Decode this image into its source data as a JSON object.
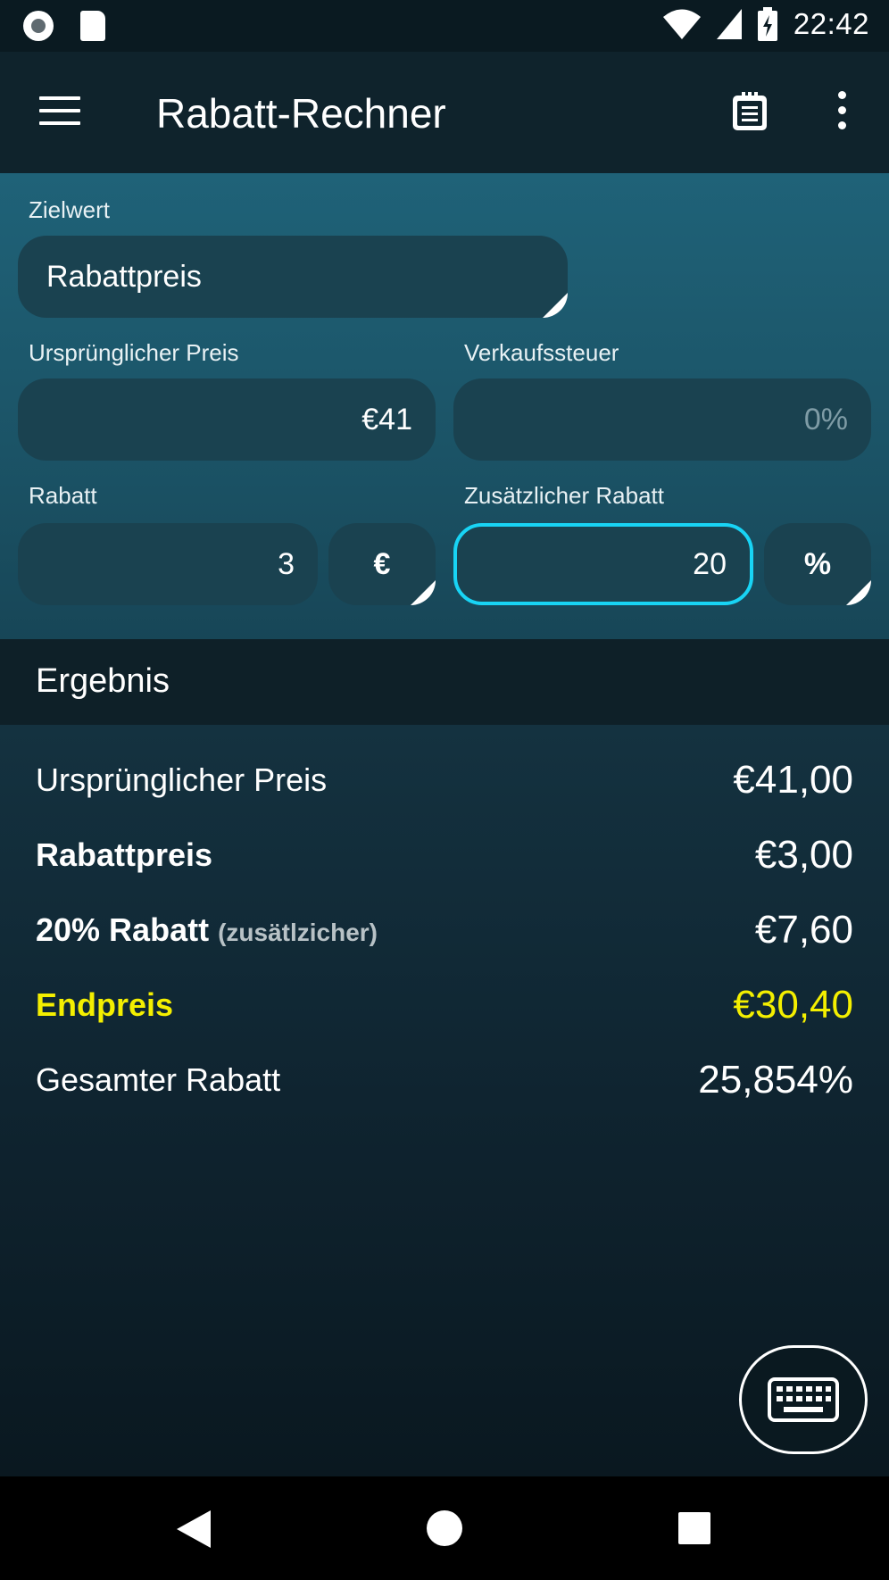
{
  "status_bar": {
    "time": "22:42",
    "icons": [
      "record-icon",
      "sd-card-icon",
      "wifi-icon",
      "signal-icon",
      "battery-charging-icon"
    ]
  },
  "app_bar": {
    "title": "Rabatt-Rechner",
    "icons": [
      "menu-icon",
      "clipboard-icon",
      "more-vert-icon"
    ]
  },
  "form": {
    "target_label": "Zielwert",
    "target_value": "Rabattpreis",
    "original_price_label": "Ursprünglicher Preis",
    "original_price_value": "€41",
    "sales_tax_label": "Verkaufssteuer",
    "sales_tax_placeholder": "0%",
    "discount_label": "Rabatt",
    "discount_value": "3",
    "discount_unit": "€",
    "extra_discount_label": "Zusätzlicher Rabatt",
    "extra_discount_value": "20",
    "extra_discount_unit": "%"
  },
  "results": {
    "header": "Ergebnis",
    "rows": [
      {
        "label": "Ursprünglicher Preis",
        "value": "€41,00"
      },
      {
        "label": "Rabattpreis",
        "value": "€3,00"
      },
      {
        "label": "20% Rabatt",
        "sub": "(zusätlzicher)",
        "value": "€7,60"
      },
      {
        "label": "Endpreis",
        "value": "€30,40"
      },
      {
        "label": "Gesamter Rabatt",
        "value": "25,854%"
      }
    ]
  },
  "colors": {
    "accent_focus": "#18d4f5",
    "final_price": "#f4ef00",
    "panel": "#1f6278",
    "background": "#0c1d25"
  },
  "fab": {
    "icon": "keyboard-icon"
  },
  "nav_bar": {
    "icons": [
      "back-icon",
      "home-icon",
      "recents-icon"
    ]
  }
}
